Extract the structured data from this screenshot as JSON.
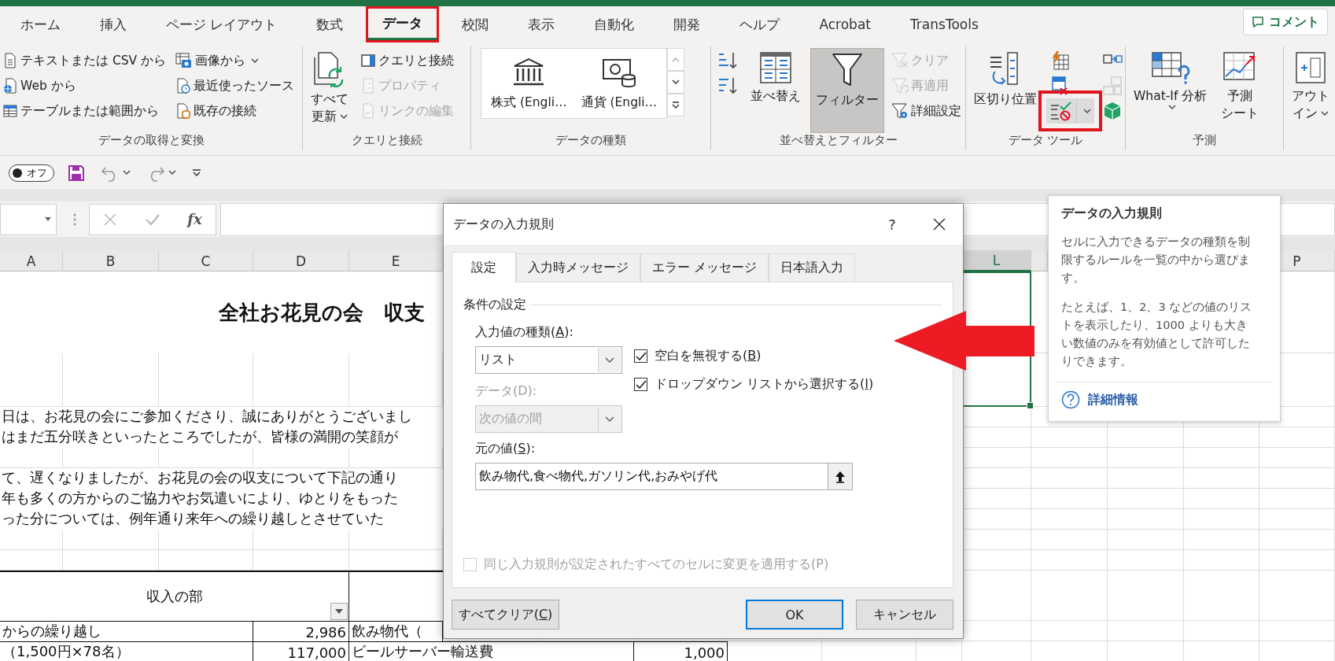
{
  "tabs": [
    {
      "label": "ホーム",
      "selected": false,
      "highlighted": false
    },
    {
      "label": "挿入",
      "selected": false,
      "highlighted": false
    },
    {
      "label": "ページ レイアウト",
      "selected": false,
      "highlighted": false
    },
    {
      "label": "数式",
      "selected": false,
      "highlighted": false
    },
    {
      "label": "データ",
      "selected": true,
      "highlighted": true
    },
    {
      "label": "校閲",
      "selected": false,
      "highlighted": false
    },
    {
      "label": "表示",
      "selected": false,
      "highlighted": false
    },
    {
      "label": "自動化",
      "selected": false,
      "highlighted": false
    },
    {
      "label": "開発",
      "selected": false,
      "highlighted": false
    },
    {
      "label": "ヘルプ",
      "selected": false,
      "highlighted": false
    },
    {
      "label": "Acrobat",
      "selected": false,
      "highlighted": false
    },
    {
      "label": "TransTools",
      "selected": false,
      "highlighted": false
    }
  ],
  "comment_button": "コメント",
  "ribbon": [
    {
      "label": "データの取得と変換",
      "columns": [
        [
          {
            "kind": "small",
            "label": "テキストまたは CSV から",
            "disabled": false,
            "dropdown": false
          },
          {
            "kind": "small",
            "label": "Web から",
            "disabled": false,
            "dropdown": false
          },
          {
            "kind": "small",
            "label": "テーブルまたは範囲から",
            "disabled": false,
            "dropdown": false
          }
        ],
        [
          {
            "kind": "small",
            "label": "画像から",
            "disabled": false,
            "dropdown": true
          },
          {
            "kind": "small",
            "label": "最近使ったソース",
            "disabled": false,
            "dropdown": false
          },
          {
            "kind": "small",
            "label": "既存の接続",
            "disabled": false,
            "dropdown": false
          }
        ]
      ]
    },
    {
      "label": "クエリと接続",
      "columns": [
        [
          {
            "kind": "large",
            "lines": [
              "すべて",
              "更新"
            ],
            "disabled": false,
            "dropdown": true,
            "pressed": false
          }
        ],
        [
          {
            "kind": "small",
            "label": "クエリと接続",
            "disabled": false,
            "dropdown": false
          },
          {
            "kind": "small",
            "label": "プロパティ",
            "disabled": true,
            "dropdown": false
          },
          {
            "kind": "small",
            "label": "リンクの編集",
            "disabled": true,
            "dropdown": false
          }
        ]
      ]
    },
    {
      "label": "データの種類",
      "columns": [
        [
          {
            "kind": "gallery",
            "items": [
              "株式 (Engli…",
              "通貨 (Engli…"
            ]
          }
        ]
      ]
    },
    {
      "label": "並べ替えとフィルター",
      "columns": [
        [
          {
            "kind": "icon",
            "disabled": false,
            "dropdown": false,
            "highlighted": false
          },
          {
            "kind": "icon",
            "disabled": false,
            "dropdown": false,
            "highlighted": false
          }
        ],
        [
          {
            "kind": "large",
            "lines": [
              "並べ替え"
            ],
            "disabled": false,
            "dropdown": false,
            "pressed": false
          }
        ],
        [
          {
            "kind": "large",
            "lines": [
              "フィルター"
            ],
            "disabled": false,
            "dropdown": false,
            "pressed": true
          }
        ],
        [
          {
            "kind": "small",
            "label": "クリア",
            "disabled": true,
            "dropdown": false
          },
          {
            "kind": "small",
            "label": "再適用",
            "disabled": true,
            "dropdown": false
          },
          {
            "kind": "small",
            "label": "詳細設定",
            "disabled": false,
            "dropdown": false
          }
        ]
      ]
    },
    {
      "label": "データ ツール",
      "columns": [
        [
          {
            "kind": "large",
            "lines": [
              "区切り位置"
            ],
            "disabled": false,
            "dropdown": false,
            "pressed": false
          }
        ],
        [
          {
            "kind": "icon",
            "disabled": false,
            "dropdown": false,
            "highlighted": false
          },
          {
            "kind": "icon",
            "disabled": false,
            "dropdown": false,
            "highlighted": false
          },
          {
            "kind": "icon",
            "disabled": false,
            "dropdown": true,
            "highlighted": true
          }
        ],
        [
          {
            "kind": "icon",
            "disabled": false,
            "dropdown": false,
            "highlighted": false
          },
          {
            "kind": "icon",
            "disabled": true,
            "dropdown": false,
            "highlighted": false
          },
          {
            "kind": "icon",
            "disabled": false,
            "dropdown": false,
            "highlighted": false
          }
        ]
      ]
    },
    {
      "label": "予測",
      "columns": [
        [
          {
            "kind": "large",
            "lines": [
              "What-If 分析"
            ],
            "disabled": false,
            "dropdown": true,
            "pressed": false
          }
        ],
        [
          {
            "kind": "large",
            "lines": [
              "予測",
              "シート"
            ],
            "disabled": false,
            "dropdown": false,
            "pressed": false
          }
        ]
      ]
    },
    {
      "columns": [
        [
          {
            "kind": "large",
            "lines": [
              "アウト",
              "イン"
            ],
            "disabled": false,
            "dropdown": true,
            "pressed": false
          }
        ]
      ]
    }
  ],
  "quick_access": {
    "autosave_label": "オフ",
    "autosave_on": false
  },
  "formula_bar": {
    "function_label": "fx"
  },
  "sheet": {
    "columns": [
      {
        "label": "A",
        "selected": false
      },
      {
        "label": "B",
        "selected": false
      },
      {
        "label": "C",
        "selected": false
      },
      {
        "label": "D",
        "selected": false
      },
      {
        "label": "E",
        "selected": false
      },
      {
        "label": "L",
        "selected": true
      },
      {
        "label": "P",
        "selected": false
      }
    ],
    "title": "全社お花見の会　収支",
    "letter_lines": [
      "日は、お花見の会にご参加くださり、誠にありがとうございまし",
      "はまだ五分咲きといったところでしたが、皆様の満開の笑顔が",
      "て、遅くなりましたが、お花見の会の収支について下記の通り",
      "年も多くの方からのご協力やお気遣いにより、ゆとりをもった",
      "った分については、例年通り来年への繰り越しとさせていた"
    ],
    "table": {
      "header": "収入の部",
      "rows": [
        [
          "からの繰り越し",
          "2,986",
          "飲み物代（"
        ],
        [
          "（1,500円×78名）",
          "117,000",
          "ビールサーバー輸送費",
          "1,000"
        ]
      ]
    }
  },
  "dialog": {
    "title": "データの入力規則",
    "help": "?",
    "tabs": [
      {
        "label": "設定",
        "selected": true
      },
      {
        "label": "入力時メッセージ",
        "selected": false
      },
      {
        "label": "エラー メッセージ",
        "selected": false
      },
      {
        "label": "日本語入力",
        "selected": false
      }
    ],
    "section": "条件の設定",
    "allow": {
      "label": {
        "before": "入力値の種類(",
        "key": "A",
        "after": "):"
      },
      "value": "リスト",
      "disabled": false
    },
    "data": {
      "label": "データ(D):",
      "value": "次の値の間",
      "disabled": true
    },
    "checkboxes": [
      {
        "label": {
          "before": "空白を無視する(",
          "key": "B",
          "after": ")"
        },
        "checked": true,
        "disabled": false
      },
      {
        "label": {
          "before": "ドロップダウン リストから選択する(",
          "key": "I",
          "after": ")"
        },
        "checked": true,
        "disabled": false
      }
    ],
    "source": {
      "label": {
        "before": "元の値(",
        "key": "S",
        "after": "):"
      },
      "value": "飲み物代,食べ物代,ガソリン代,おみやげ代"
    },
    "apply_all": {
      "label": "同じ入力規則が設定されたすべてのセルに変更を適用する(P)",
      "checked": false,
      "disabled": true
    },
    "buttons": [
      {
        "label": {
          "before": "すべてクリア(",
          "key": "C",
          "after": ")"
        },
        "default": false
      },
      {
        "label": "OK",
        "default": true
      },
      {
        "label": "キャンセル",
        "default": false
      }
    ]
  },
  "tooltip": {
    "title": "データの入力規則",
    "paragraphs": [
      "セルに入力できるデータの種類を制限するルールを一覧の中から選びます。",
      "たとえば、1、2、3 などの値のリストを表示したり、1000 よりも大きい数値のみを有効値として許可したりできます。"
    ],
    "link": "詳細情報"
  }
}
